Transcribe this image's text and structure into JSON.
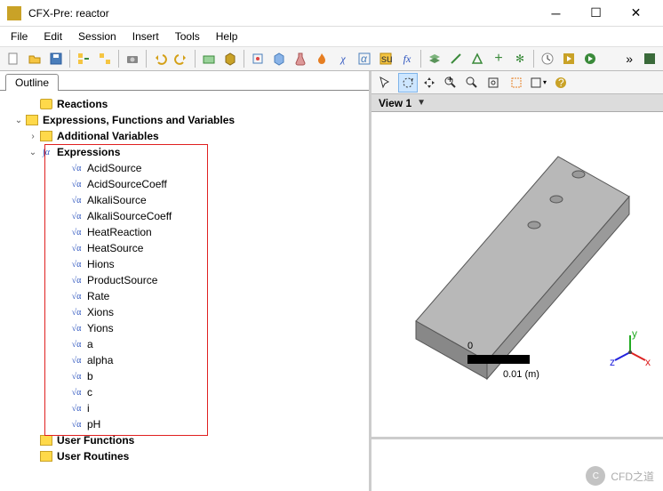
{
  "window": {
    "title": "CFX-Pre: reactor"
  },
  "menu": {
    "file": "File",
    "edit": "Edit",
    "session": "Session",
    "insert": "Insert",
    "tools": "Tools",
    "help": "Help"
  },
  "outline": {
    "tab": "Outline"
  },
  "tree": {
    "reactions": "Reactions",
    "efv": "Expressions, Functions and Variables",
    "addvars": "Additional Variables",
    "expressions": "Expressions",
    "items": [
      "AcidSource",
      "AcidSourceCoeff",
      "AlkaliSource",
      "AlkaliSourceCoeff",
      "HeatReaction",
      "HeatSource",
      "Hions",
      "ProductSource",
      "Rate",
      "Xions",
      "Yions",
      "a",
      "alpha",
      "b",
      "c",
      "i",
      "pH"
    ],
    "userfunc": "User Functions",
    "userrout": "User Routines"
  },
  "view": {
    "label": "View 1"
  },
  "ruler": {
    "zero": "0",
    "scale": "0.01 (m)"
  },
  "watermark": "CFD之道"
}
